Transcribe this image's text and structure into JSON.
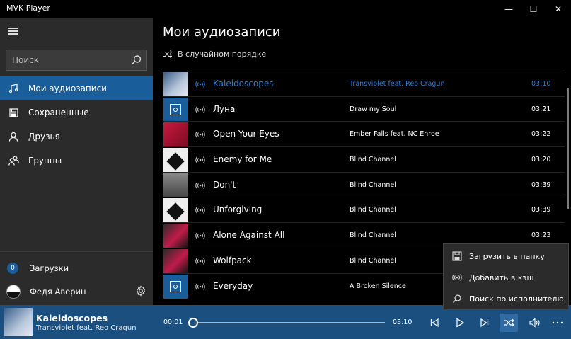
{
  "window": {
    "title": "MVK Player",
    "controls": {
      "minimize": "—",
      "maximize": "☐",
      "close": "✕"
    }
  },
  "sidebar": {
    "search_placeholder": "Поиск",
    "nav": [
      {
        "label": "Мои аудиозаписи",
        "icon": "music-note-icon",
        "active": true
      },
      {
        "label": "Сохраненные",
        "icon": "save-disk-icon",
        "active": false
      },
      {
        "label": "Друзья",
        "icon": "person-icon",
        "active": false
      },
      {
        "label": "Группы",
        "icon": "people-icon",
        "active": false
      }
    ],
    "downloads": {
      "count": "0",
      "label": "Загрузки"
    },
    "user": {
      "name": "Федя Аверин"
    }
  },
  "main": {
    "title": "Мои аудиозаписи",
    "shuffle_label": "В случайном порядке",
    "tracks": [
      {
        "title": "Kaleidoscopes",
        "artist": "Transviolet feat. Reo Cragun",
        "duration": "03:10",
        "playing": true
      },
      {
        "title": "Луна",
        "artist": "Draw my Soul",
        "duration": "03:21",
        "playing": false
      },
      {
        "title": "Open Your Eyes",
        "artist": "Ember Falls feat. NC Enroe",
        "duration": "03:22",
        "playing": false
      },
      {
        "title": "Enemy for Me",
        "artist": "Blind Channel",
        "duration": "03:20",
        "playing": false
      },
      {
        "title": "Don't",
        "artist": "Blind Channel",
        "duration": "03:39",
        "playing": false
      },
      {
        "title": "Unforgiving",
        "artist": "Blind Channel",
        "duration": "03:39",
        "playing": false
      },
      {
        "title": "Alone Against All",
        "artist": "Blind Channel",
        "duration": "03:23",
        "playing": false
      },
      {
        "title": "Wolfpack",
        "artist": "Blind Channel",
        "duration": "",
        "playing": false
      },
      {
        "title": "Everyday",
        "artist": "A Broken Silence",
        "duration": "",
        "playing": false
      }
    ]
  },
  "context_menu": {
    "items": [
      {
        "label": "Загрузить в папку",
        "icon": "save-disk-icon"
      },
      {
        "label": "Добавить в кэш",
        "icon": "broadcast-icon"
      },
      {
        "label": "Поиск по исполнителю",
        "icon": "search-icon"
      }
    ]
  },
  "player": {
    "title": "Kaleidoscopes",
    "artist": "Transviolet feat. Reo Cragun",
    "elapsed": "00:01",
    "total": "03:10",
    "progress": 0.005,
    "shuffle_active": true
  },
  "colors": {
    "accent": "#1a5d9b",
    "player_bg": "#1a4f80",
    "playing_text": "#2b7cd3",
    "sidebar_bg": "#2b2b2b"
  }
}
